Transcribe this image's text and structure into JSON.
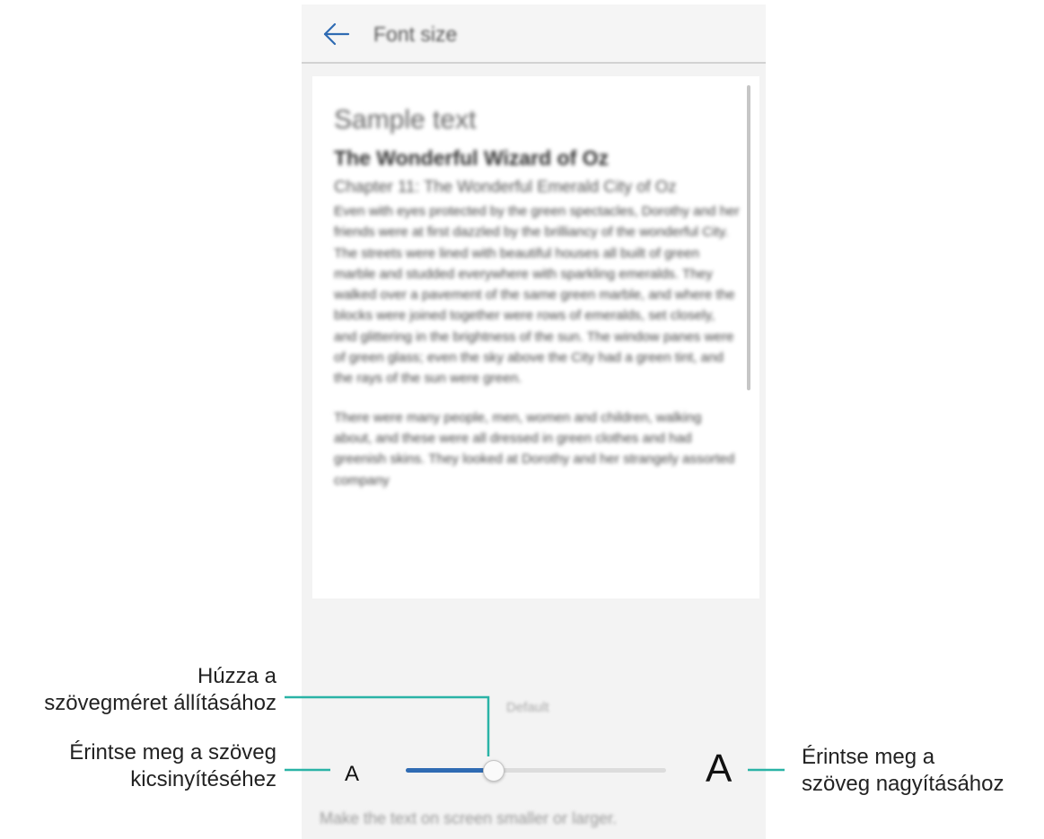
{
  "screen": {
    "header": {
      "title": "Font size",
      "back_icon": "arrow-left-icon"
    },
    "sample": {
      "heading": "Sample text",
      "book_title": "The Wonderful Wizard of Oz",
      "chapter": "Chapter 11: The Wonderful Emerald City of Oz",
      "paragraphs": [
        "Even with eyes protected by the green spectacles, Dorothy and her friends were at first dazzled by the brilliancy of the wonderful City. The streets were lined with beautiful houses all built of green marble and studded everywhere with sparkling emeralds. They walked over a pavement of the same green marble, and where the blocks were joined together were rows of emeralds, set closely, and glittering in the brightness of the sun. The window panes were of green glass; even the sky above the City had a green tint, and the rays of the sun were green.",
        "There were many people, men, women and children, walking about, and these were all dressed in green clothes and had greenish skins. They looked at Dorothy and her strangely assorted company"
      ]
    },
    "slider": {
      "default_label": "Default",
      "small_label": "A",
      "large_label": "A",
      "level_fraction": 0.333
    },
    "hint": "Make the text on screen smaller or larger."
  },
  "callouts": {
    "drag": "Húzza a\nszövegméret állításához",
    "shrink": "Érintse meg a szöveg\nkicsinyítéséhez",
    "enlarge": "Érintse meg a\nszöveg nagyításához"
  },
  "colors": {
    "accent": "#2f6bb3",
    "leader_line": "#2ab3a6"
  }
}
